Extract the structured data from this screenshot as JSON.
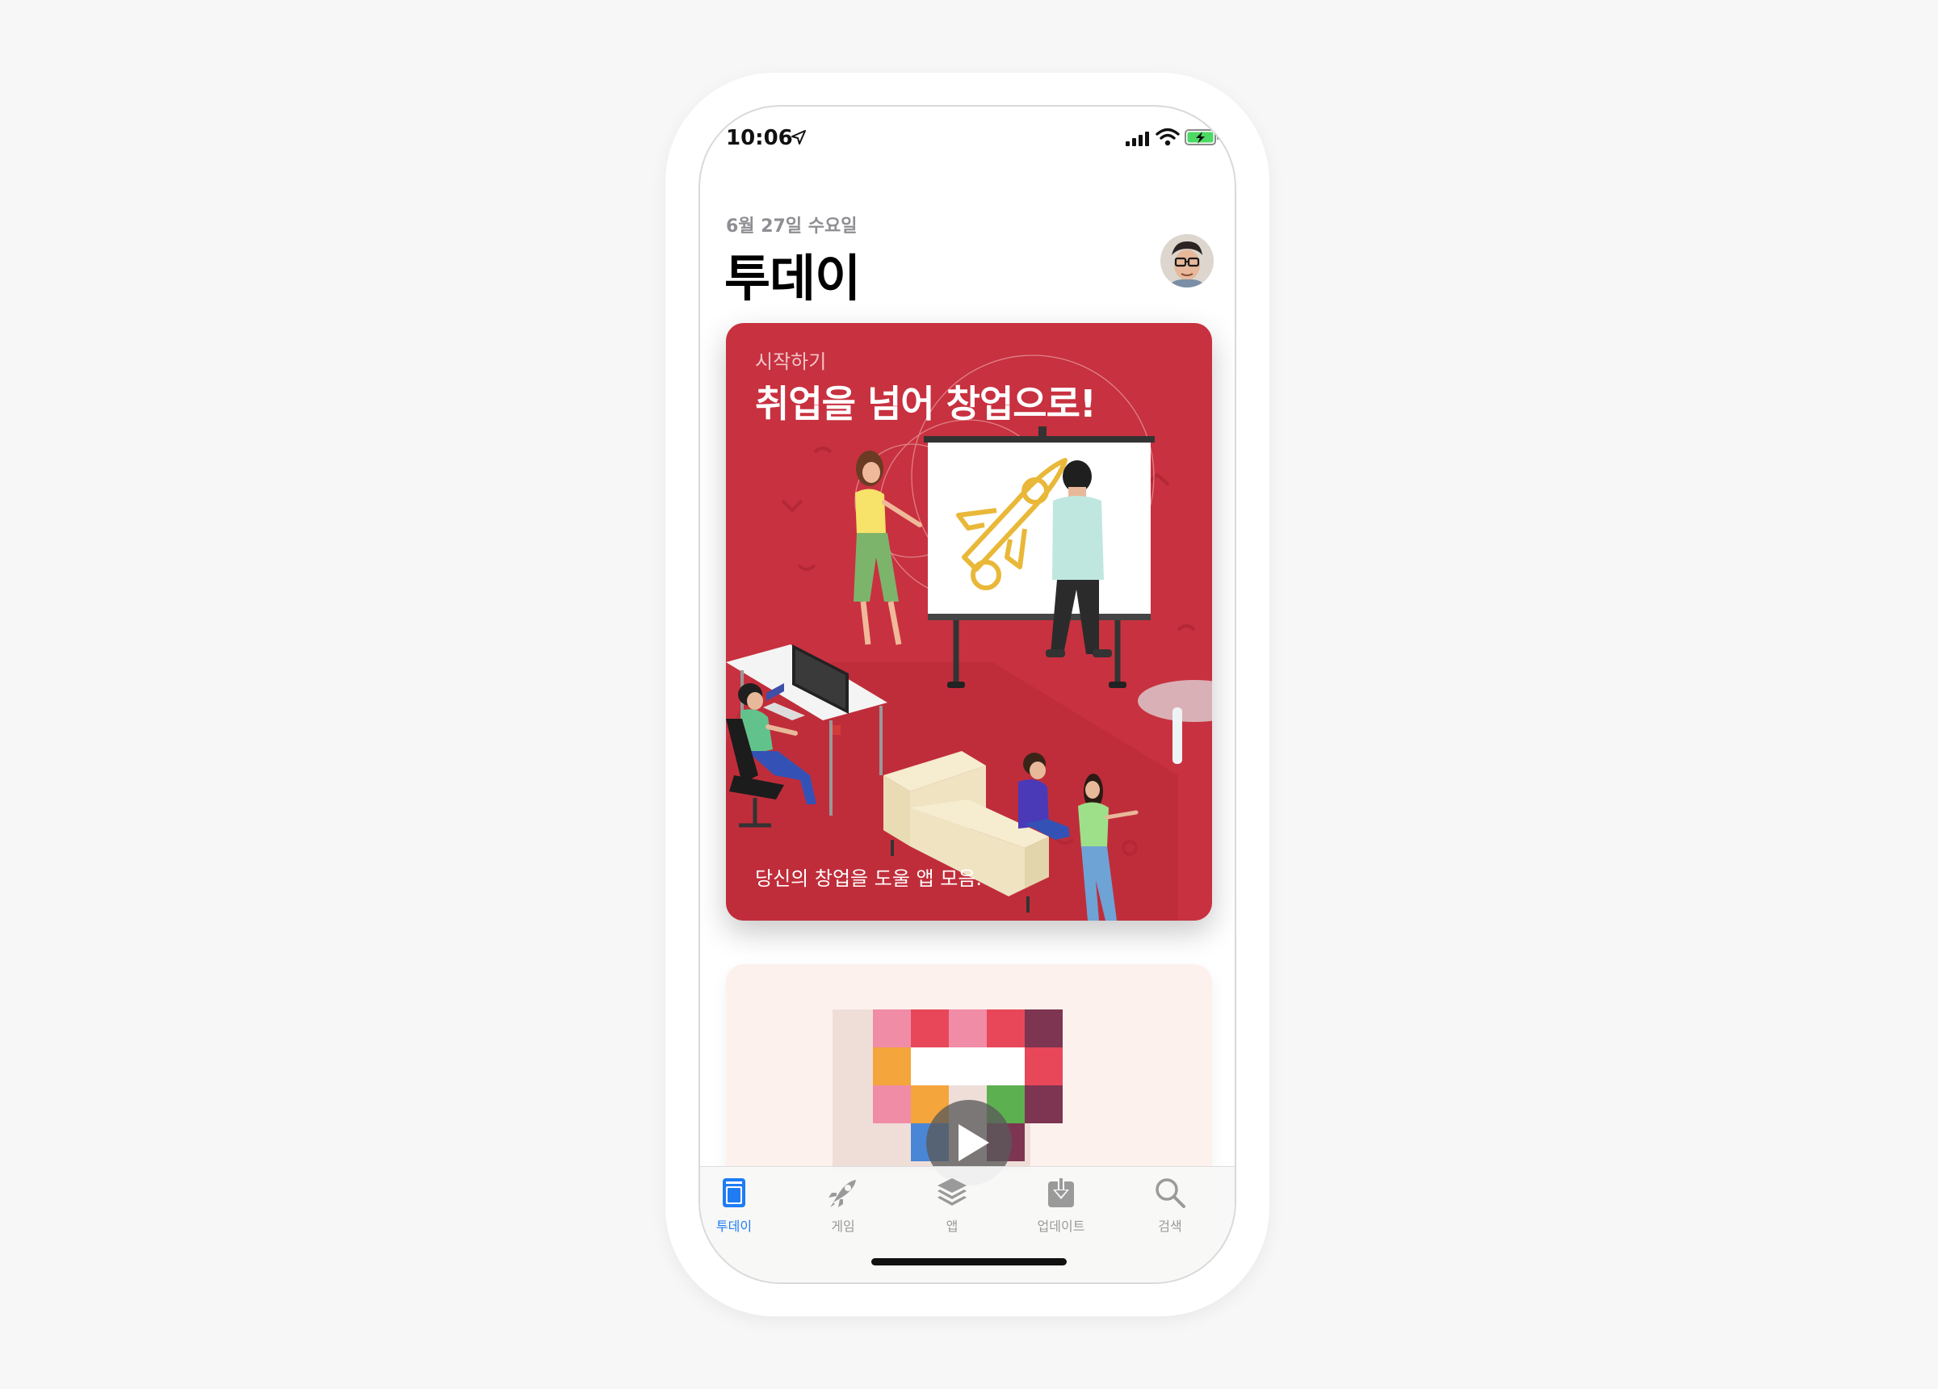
{
  "status_bar": {
    "time": "10:06"
  },
  "header": {
    "date": "6월 27일 수요일",
    "title": "투데이"
  },
  "today_card": {
    "eyebrow": "시작하기",
    "title": "취업을 넘어 창업으로!",
    "subtitle": "당신의 창업을 도울 앱 모음.",
    "background_color": "#c8313f"
  },
  "second_card": {
    "background_color": "#fdf1ed",
    "play_icon": "play-icon"
  },
  "tab_bar": {
    "items": [
      {
        "label": "투데이",
        "icon": "today-icon",
        "active": true
      },
      {
        "label": "게임",
        "icon": "rocket-icon",
        "active": false
      },
      {
        "label": "앱",
        "icon": "layers-icon",
        "active": false
      },
      {
        "label": "업데이트",
        "icon": "download-icon",
        "active": false
      },
      {
        "label": "검색",
        "icon": "search-icon",
        "active": false
      }
    ],
    "active_color": "#1f7cf4",
    "inactive_color": "#9a9a9a"
  }
}
